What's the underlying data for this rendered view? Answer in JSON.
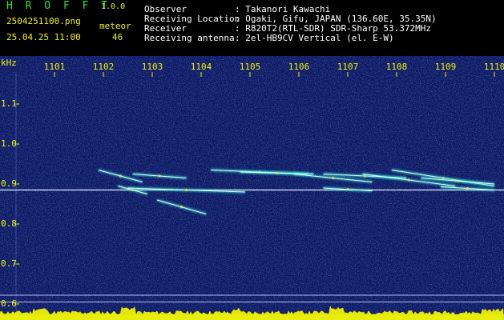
{
  "header": {
    "app_name": "H R O F F T",
    "version": "1.0.0",
    "filename": "2504251100.png",
    "datetime": "25.04.25 11:00",
    "meteor_label": "meteor",
    "meteor_count": "46",
    "info": [
      {
        "label": "Observer",
        "value": ": Takanori Kawachi"
      },
      {
        "label": "Receiving Location",
        "value": ": Ogaki, Gifu, JAPAN (136.60E, 35.35N)"
      },
      {
        "label": "Receiver",
        "value": ": R820T2(RTL-SDR) SDR-Sharp 53.372MHz"
      },
      {
        "label": "Receiving antenna",
        "value": ": 2el-HB9CV Vertical (el. E-W)"
      }
    ]
  },
  "chart_data": {
    "type": "heatmap",
    "ylabel": "kHz",
    "x_ticks": [
      "1101",
      "1102",
      "1103",
      "1104",
      "1105",
      "1106",
      "1107",
      "1108",
      "1109",
      "1110"
    ],
    "y_ticks": [
      "1.1",
      "1.0",
      "0.9",
      "0.8",
      "0.7",
      "0.6"
    ],
    "ylim": [
      0.58,
      1.18
    ],
    "carrier_khz": 0.885,
    "reference_lines_khz": [
      0.622,
      0.605
    ],
    "meteor_traces": [
      {
        "t": [
          1101.9,
          1102.8
        ],
        "f": [
          0.935,
          0.905
        ]
      },
      {
        "t": [
          1102.3,
          1102.9
        ],
        "f": [
          0.895,
          0.875
        ]
      },
      {
        "t": [
          1102.6,
          1103.7
        ],
        "f": [
          0.925,
          0.915
        ]
      },
      {
        "t": [
          1103.1,
          1104.1
        ],
        "f": [
          0.86,
          0.825
        ]
      },
      {
        "t": [
          1102.5,
          1104.9
        ],
        "f": [
          0.89,
          0.88
        ]
      },
      {
        "t": [
          1104.2,
          1106.2
        ],
        "f": [
          0.935,
          0.925
        ]
      },
      {
        "t": [
          1104.8,
          1106.3
        ],
        "f": [
          0.93,
          0.925
        ]
      },
      {
        "t": [
          1105.9,
          1107.5
        ],
        "f": [
          0.925,
          0.905
        ]
      },
      {
        "t": [
          1106.5,
          1108.2
        ],
        "f": [
          0.925,
          0.915
        ]
      },
      {
        "t": [
          1107.3,
          1109.2
        ],
        "f": [
          0.925,
          0.895
        ]
      },
      {
        "t": [
          1107.9,
          1110.0
        ],
        "f": [
          0.935,
          0.895
        ]
      },
      {
        "t": [
          1108.5,
          1110.0
        ],
        "f": [
          0.915,
          0.9
        ]
      },
      {
        "t": [
          1106.5,
          1107.5
        ],
        "f": [
          0.89,
          0.883
        ]
      },
      {
        "t": [
          1108.9,
          1110.0
        ],
        "f": [
          0.893,
          0.885
        ]
      }
    ],
    "colors": {
      "background": "#0a1560",
      "noise_light": "#2b4fb0",
      "carrier": "#e0f0ff",
      "trace_core": "#ffffff",
      "trace_glow": "#30ffe0",
      "trace_hot": "#ffd040",
      "spectrum_fill": "#f0f000",
      "spectrum_base": "#40c0ff",
      "tick_text": "#f0f000"
    }
  }
}
